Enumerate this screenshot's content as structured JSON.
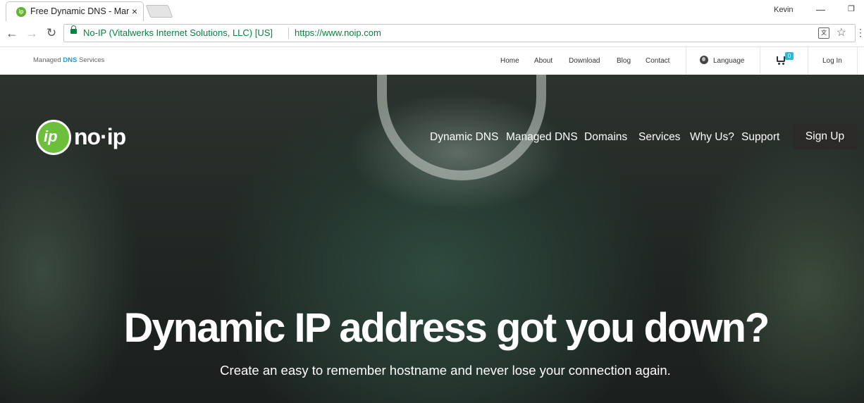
{
  "browser": {
    "tab_title": "Free Dynamic DNS - Man",
    "tab_close": "×",
    "profile_name": "Kevin",
    "minimize": "—",
    "restore": "❐",
    "secure_org": "No-IP (Vitalwerks Internet Solutions, LLC) [US]",
    "url": "https://www.noip.com"
  },
  "utility_bar": {
    "tagline_prefix": "Managed ",
    "tagline_highlight": "DNS",
    "tagline_suffix": " Services",
    "links": {
      "home": "Home",
      "about": "About",
      "download": "Download",
      "blog": "Blog",
      "contact": "Contact",
      "language": "Language",
      "login": "Log In"
    },
    "cart_count": "0"
  },
  "hero": {
    "logo_text": "no·ip",
    "nav": {
      "dynamic_dns": "Dynamic DNS",
      "managed_dns": "Managed DNS",
      "domains": "Domains",
      "services": "Services",
      "why_us": "Why Us?",
      "support": "Support",
      "sign_up": "Sign Up"
    },
    "headline": "Dynamic IP address got you down?",
    "subline": "Create an easy to remember hostname and never lose your connection again."
  },
  "colors": {
    "brand_green": "#6cbf3a",
    "secure_green": "#0b8043",
    "dns_blue": "#1a9fd8",
    "cart_badge": "#2cb8d9",
    "signup_bg": "#2b2a28"
  }
}
